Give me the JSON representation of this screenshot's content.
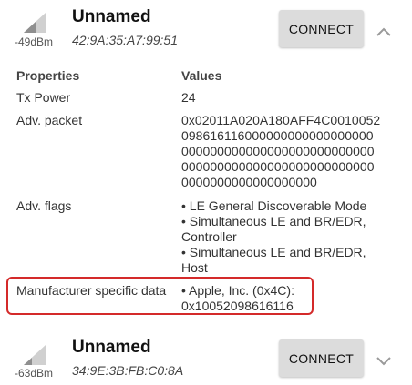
{
  "devices": [
    {
      "rssi": "-49dBm",
      "name": "Unnamed",
      "mac": "42:9A:35:A7:99:51",
      "connect_label": "CONNECT",
      "expanded": true
    },
    {
      "rssi": "-63dBm",
      "name": "Unnamed",
      "mac": "34:9E:3B:FB:C0:8A",
      "connect_label": "CONNECT",
      "expanded": false
    }
  ],
  "properties": {
    "header_properties": "Properties",
    "header_values": "Values",
    "rows": [
      {
        "label": "Tx Power",
        "value_lines": [
          "24"
        ]
      },
      {
        "label": "Adv. packet",
        "value_lines": [
          "0x02011A020A180AFF4C0010052",
          "098616116000000000000000000",
          "000000000000000000000000000",
          "000000000000000000000000000",
          "0000000000000000000"
        ]
      },
      {
        "label": "Adv. flags",
        "value_lines": [
          "• LE General Discoverable Mode",
          "• Simultaneous LE and BR/EDR,",
          "Controller",
          "• Simultaneous LE and BR/EDR,",
          "Host"
        ]
      },
      {
        "label": "Manufacturer specific data",
        "value_lines": [
          "• Apple, Inc. (0x4C):",
          "0x10052098616116"
        ]
      }
    ]
  },
  "colors": {
    "highlight": "#d42a2a",
    "button_bg": "#dcdcdc",
    "signal_light": "#cccccc",
    "signal_dark": "#888888"
  }
}
